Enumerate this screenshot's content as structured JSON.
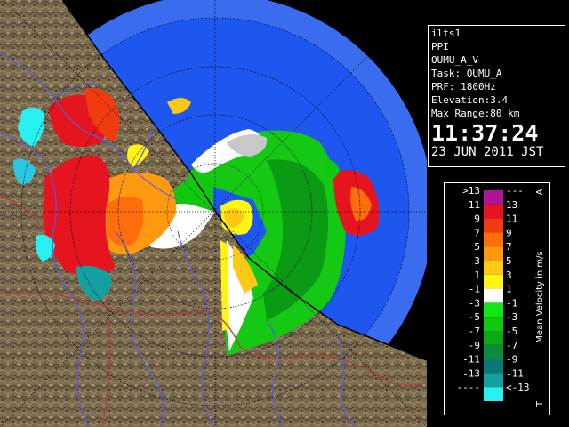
{
  "info": {
    "site": "ilts1",
    "scan_type": "PPI",
    "product": "OUMU_A_V",
    "task": "Task: OUMU_A",
    "prf": "PRF: 1800Hz",
    "elevation": "Elevation:3.4",
    "max_range": "Max Range:80 km",
    "time": "11:37:24",
    "date": "23 JUN 2011 JST"
  },
  "legend": {
    "title": "Mean Velocity in m/s",
    "top_marker": "A",
    "bottom_marker": "T",
    "entries": [
      {
        "left": ">13",
        "right": "---",
        "color": "#b0129a"
      },
      {
        "left": "11",
        "right": "13",
        "color": "#e6141e"
      },
      {
        "left": "9",
        "right": "11",
        "color": "#f03a10"
      },
      {
        "left": "7",
        "right": "9",
        "color": "#ff6e0a"
      },
      {
        "left": "5",
        "right": "7",
        "color": "#ff9a10"
      },
      {
        "left": "3",
        "right": "5",
        "color": "#ffc814"
      },
      {
        "left": "1",
        "right": "3",
        "color": "#fff514"
      },
      {
        "left": "-1",
        "right": "1",
        "color": "#ffffff"
      },
      {
        "left": "-3",
        "right": "-1",
        "color": "#14e614"
      },
      {
        "left": "-5",
        "right": "-3",
        "color": "#0fc80f"
      },
      {
        "left": "-7",
        "right": "-5",
        "color": "#0aaa14"
      },
      {
        "left": "-9",
        "right": "-7",
        "color": "#0a8c3c"
      },
      {
        "left": "-11",
        "right": "-9",
        "color": "#0a7878"
      },
      {
        "left": "-13",
        "right": "-11",
        "color": "#14a0a0"
      },
      {
        "left": "----",
        "right": "<-13",
        "color": "#28f0f0"
      }
    ]
  },
  "colors": {
    "coverage_outer": "#3a6cf0",
    "coverage_inner": "#1e56f0",
    "terrain": "#7a6a4e",
    "ocean": "#000000",
    "rivers": "#5a5ae0",
    "boundaries": "#b04040"
  }
}
